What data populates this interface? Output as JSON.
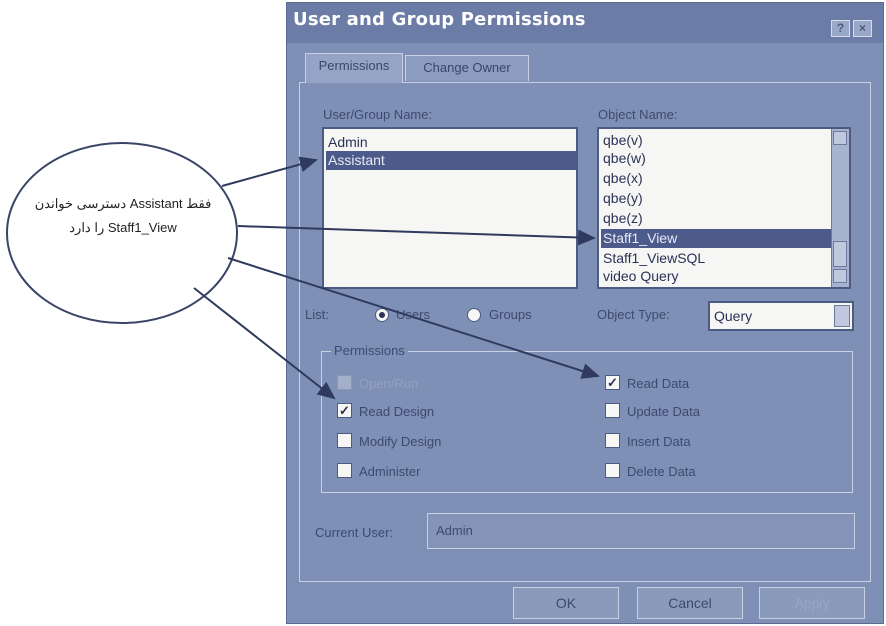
{
  "window": {
    "title": "User and Group Permissions",
    "help_glyph": "?",
    "close_glyph": "×"
  },
  "tabs": [
    {
      "label": "Permissions",
      "active": true
    },
    {
      "label": "Change Owner",
      "active": false
    }
  ],
  "user_group": {
    "label": "User/Group Name:",
    "items": [
      "Admin",
      "Assistant"
    ],
    "selected": "Assistant"
  },
  "object": {
    "label": "Object Name:",
    "items": [
      "qbe(v)",
      "qbe(w)",
      "qbe(x)",
      "qbe(y)",
      "qbe(z)",
      "Staff1_View",
      "Staff1_ViewSQL",
      "video Query"
    ],
    "selected": "Staff1_View"
  },
  "list": {
    "label": "List:",
    "options": [
      {
        "label": "Users",
        "checked": true
      },
      {
        "label": "Groups",
        "checked": false
      }
    ]
  },
  "object_type": {
    "label": "Object Type:",
    "value": "Query"
  },
  "permissions": {
    "group_label": "Permissions",
    "left": [
      {
        "label": "Open/Run",
        "checked": false,
        "enabled": false
      },
      {
        "label": "Read Design",
        "checked": true,
        "enabled": true
      },
      {
        "label": "Modify Design",
        "checked": false,
        "enabled": true
      },
      {
        "label": "Administer",
        "checked": false,
        "enabled": true
      }
    ],
    "right": [
      {
        "label": "Read Data",
        "checked": true,
        "enabled": true
      },
      {
        "label": "Update Data",
        "checked": false,
        "enabled": true
      },
      {
        "label": "Insert Data",
        "checked": false,
        "enabled": true
      },
      {
        "label": "Delete Data",
        "checked": false,
        "enabled": true
      }
    ]
  },
  "current_user": {
    "label": "Current User:",
    "value": "Admin"
  },
  "buttons": {
    "ok": "OK",
    "cancel": "Cancel",
    "apply": "Apply"
  },
  "annotation": {
    "text": "فقط Assistant دسترسی خواندن Staff1_View را دارد"
  },
  "colors": {
    "window_bg": "#7f90b6",
    "selection": "#4c5b8c",
    "list_bg": "#f6f6f4"
  }
}
